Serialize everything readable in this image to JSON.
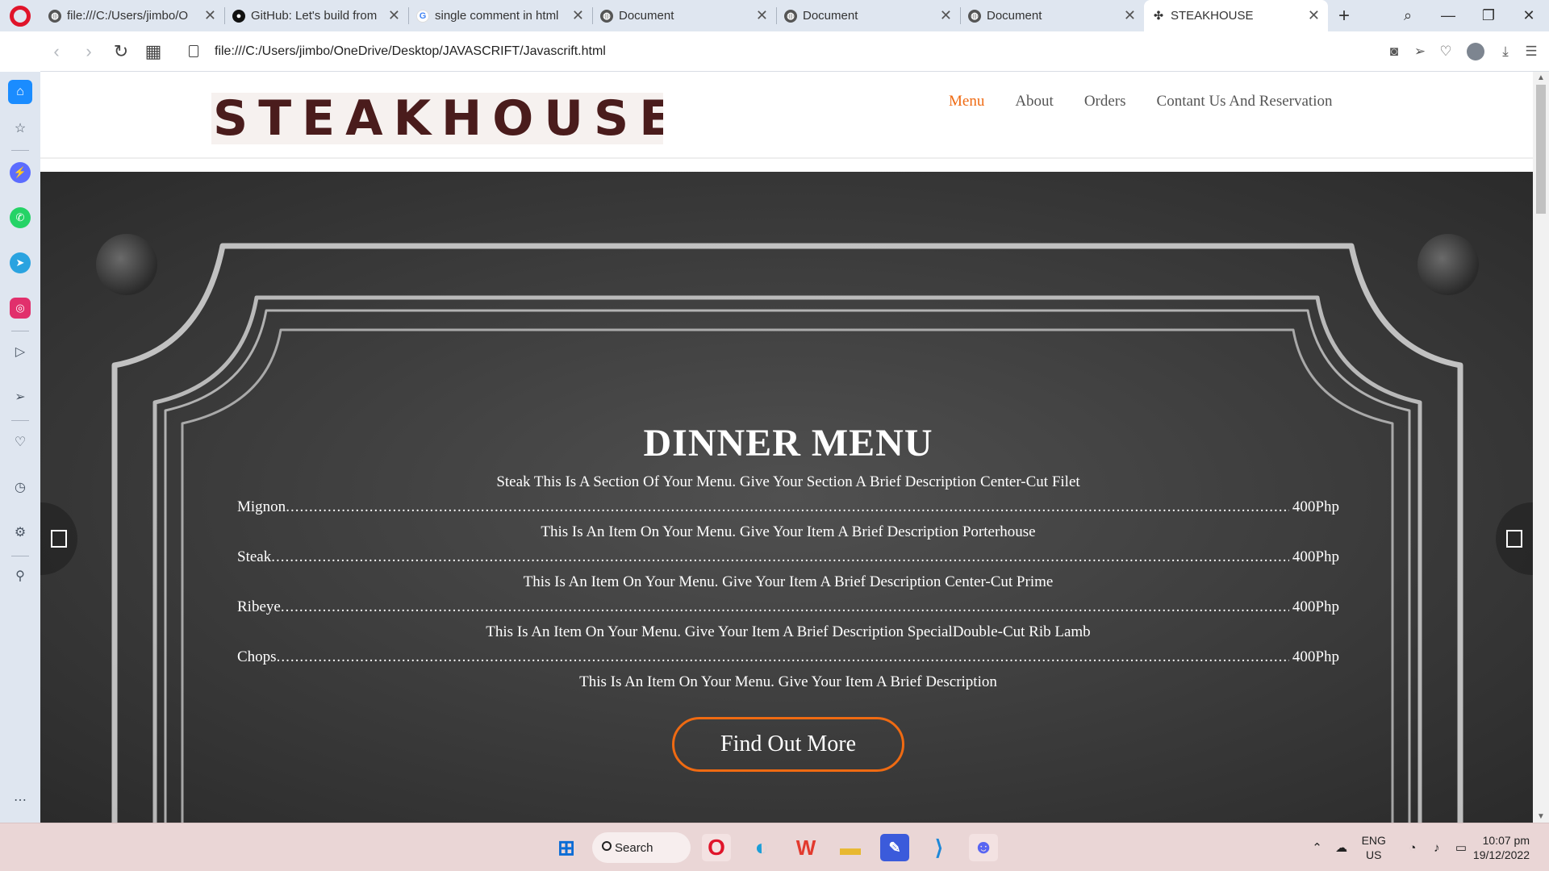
{
  "browser": {
    "tabs": [
      {
        "label": "file:///C:/Users/jimbo/O",
        "icon": "globe-icon",
        "active": false
      },
      {
        "label": "GitHub: Let's build from",
        "icon": "github-icon",
        "active": false
      },
      {
        "label": "single comment in html",
        "icon": "google-icon",
        "active": false
      },
      {
        "label": "Document",
        "icon": "globe-icon",
        "active": false
      },
      {
        "label": "Document",
        "icon": "globe-icon",
        "active": false
      },
      {
        "label": "Document",
        "icon": "globe-icon",
        "active": false
      },
      {
        "label": "STEAKHOUSE",
        "icon": "puzzle-icon",
        "active": true
      }
    ],
    "address": "file:///C:/Users/jimbo/OneDrive/Desktop/JAVASCRIFT/Javascrift.html"
  },
  "site": {
    "logo": "STEAKHOUSE",
    "nav": [
      "Menu",
      "About",
      "Orders",
      "Contant Us And Reservation"
    ],
    "accent_color": "#ef6a12"
  },
  "menu": {
    "title": "DINNER MENU",
    "lines": [
      {
        "desc": "Steak This Is A Section Of Your Menu. Give Your Section A Brief Description Center-Cut Filet",
        "item": "Mignon",
        "price": "400Php"
      },
      {
        "desc": "This Is An Item On Your Menu. Give Your Item A Brief Description Porterhouse",
        "item": "Steak",
        "price": "400Php"
      },
      {
        "desc": "This Is An Item On Your Menu. Give Your Item A Brief Description Center-Cut Prime",
        "item": "Ribeye",
        "price": "400Php"
      },
      {
        "desc": "This Is An Item On Your Menu. Give Your Item A Brief Description SpecialDouble-Cut Rib Lamb",
        "item": "Chops",
        "price": "400Php"
      }
    ],
    "last_desc": "This Is An Item On Your Menu. Give Your Item A Brief Description",
    "cta": "Find Out More"
  },
  "taskbar": {
    "search_label": "Search",
    "lang_line1": "ENG",
    "lang_line2": "US",
    "time": "10:07 pm",
    "date": "19/12/2022"
  }
}
